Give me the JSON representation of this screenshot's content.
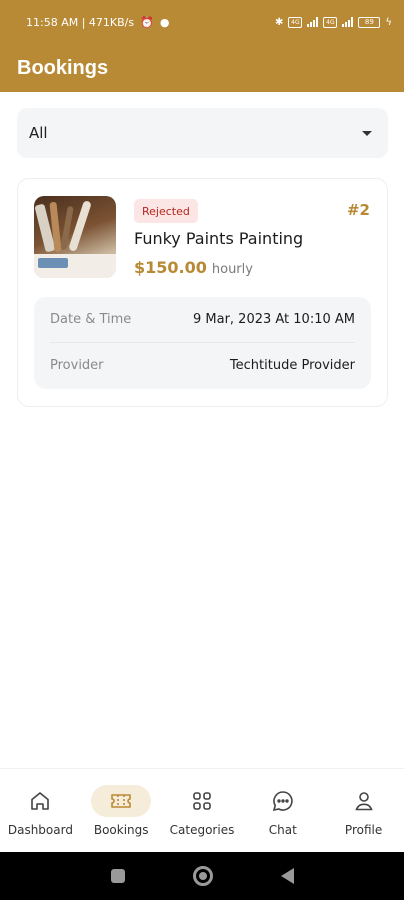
{
  "status_bar": {
    "time_info": "11:58 AM | 471KB/s",
    "lte1": "4G",
    "lte2": "4G",
    "battery": "89"
  },
  "header": {
    "title": "Bookings"
  },
  "filter": {
    "selected": "All"
  },
  "booking": {
    "status": "Rejected",
    "number": "#2",
    "service": "Funky Paints Painting",
    "price": "$150.00",
    "price_unit": "hourly",
    "date_label": "Date & Time",
    "date_value": "9 Mar, 2023 At 10:10 AM",
    "provider_label": "Provider",
    "provider_value": "Techtitude Provider"
  },
  "bottom_nav": {
    "items": [
      {
        "label": "Dashboard",
        "icon": "home-icon"
      },
      {
        "label": "Bookings",
        "icon": "ticket-icon",
        "active": true
      },
      {
        "label": "Categories",
        "icon": "grid-icon"
      },
      {
        "label": "Chat",
        "icon": "chat-icon"
      },
      {
        "label": "Profile",
        "icon": "user-icon"
      }
    ]
  },
  "colors": {
    "brand": "#b88a35",
    "rejected_bg": "#fbe5e5",
    "rejected_text": "#b3261e",
    "active_nav_bg": "#f6ecda"
  }
}
